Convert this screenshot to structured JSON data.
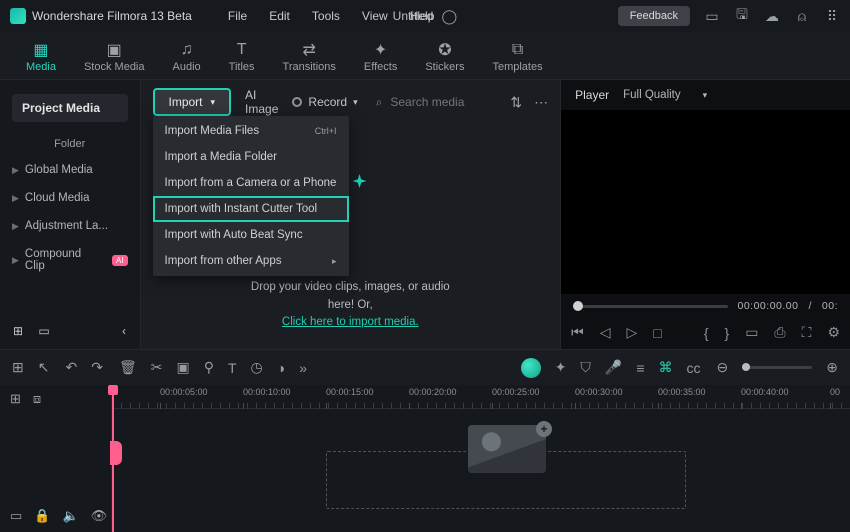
{
  "titlebar": {
    "app_name": "Wondershare Filmora 13 Beta",
    "menus": [
      "File",
      "Edit",
      "Tools",
      "View",
      "Help"
    ],
    "doc_title": "Untitled",
    "feedback": "Feedback"
  },
  "main_tabs": [
    {
      "label": "Media",
      "icon": "▦"
    },
    {
      "label": "Stock Media",
      "icon": "▣"
    },
    {
      "label": "Audio",
      "icon": "♫"
    },
    {
      "label": "Titles",
      "icon": "T"
    },
    {
      "label": "Transitions",
      "icon": "⇄"
    },
    {
      "label": "Effects",
      "icon": "✦"
    },
    {
      "label": "Stickers",
      "icon": "✪"
    },
    {
      "label": "Templates",
      "icon": "⧉"
    }
  ],
  "sidebar": {
    "project_media": "Project Media",
    "folder": "Folder",
    "items": [
      {
        "label": "Global Media"
      },
      {
        "label": "Cloud Media"
      },
      {
        "label": "Adjustment La..."
      },
      {
        "label": "Compound Clip",
        "badge": "AI"
      }
    ]
  },
  "media_toolbar": {
    "import": "Import",
    "ai_image": "AI Image",
    "record": "Record",
    "search_placeholder": "Search media"
  },
  "import_menu": [
    {
      "label": "Import Media Files",
      "accel": "Ctrl+I"
    },
    {
      "label": "Import a Media Folder"
    },
    {
      "label": "Import from a Camera or a Phone"
    },
    {
      "label": "Import with Instant Cutter Tool",
      "highlight": true
    },
    {
      "label": "Import with Auto Beat Sync"
    },
    {
      "label": "Import from other Apps",
      "submenu": true
    }
  ],
  "drop_hint": {
    "line1": "Drop your video clips, images, or audio here! Or,",
    "link": "Click here to import media."
  },
  "player": {
    "tab": "Player",
    "quality": "Full Quality",
    "time_current": "00:00:00.00",
    "time_sep": "/",
    "time_total": "00:"
  },
  "ruler_marks": [
    "00:00:05:00",
    "00:00:10:00",
    "00:00:15:00",
    "00:00:20:00",
    "00:00:25:00",
    "00:00:30:00",
    "00:00:35:00",
    "00:00:40:00"
  ],
  "ruler_end": "00"
}
